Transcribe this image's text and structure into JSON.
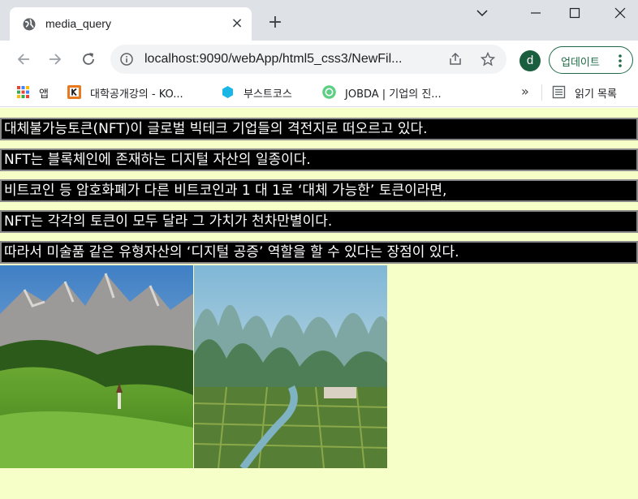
{
  "browser": {
    "tab": {
      "title": "media_query",
      "close_glyph": "×",
      "icon": "globe-icon"
    },
    "new_tab_glyph": "+",
    "address": {
      "url": "localhost:9090/webApp/html5_css3/NewFil..."
    },
    "profile_initial": "d",
    "update_label": "업데이트",
    "bookmarks": [
      {
        "label": "앱",
        "icon": "apps-grid-icon"
      },
      {
        "label": "대학공개강의 - KO...",
        "icon": "kocw-icon"
      },
      {
        "label": "부스트코스",
        "icon": "boostcourse-icon"
      },
      {
        "label": "JOBDA | 기업의 진...",
        "icon": "jobda-icon"
      }
    ],
    "more_bookmarks_glyph": "»",
    "reading_list_label": "읽기 목록",
    "colors": {
      "tabstrip": "#dee1e6",
      "accent_green": "#1e6a47"
    }
  },
  "page": {
    "background": "#f6ffc8",
    "paragraphs": [
      "대체불가능토큰(NFT)이 글로벌 빅테크 기업들의 격전지로 떠오르고 있다.",
      "NFT는 블록체인에 존재하는 디지털 자산의 일종이다.",
      "비트코인 등 암호화폐가 다른 비트코인과 1 대 1로 ‘대체 가능한’ 토큰이라면,",
      "NFT는 각각의 토큰이 모두 달라 그 가치가 천차만별이다.",
      "따라서 미술품 같은 유형자산의 ‘디지털 공증’ 역할을 할 수 있다는 장점이 있다."
    ],
    "images": [
      "alpine-mountain-meadow-image",
      "karst-river-valley-image"
    ]
  }
}
